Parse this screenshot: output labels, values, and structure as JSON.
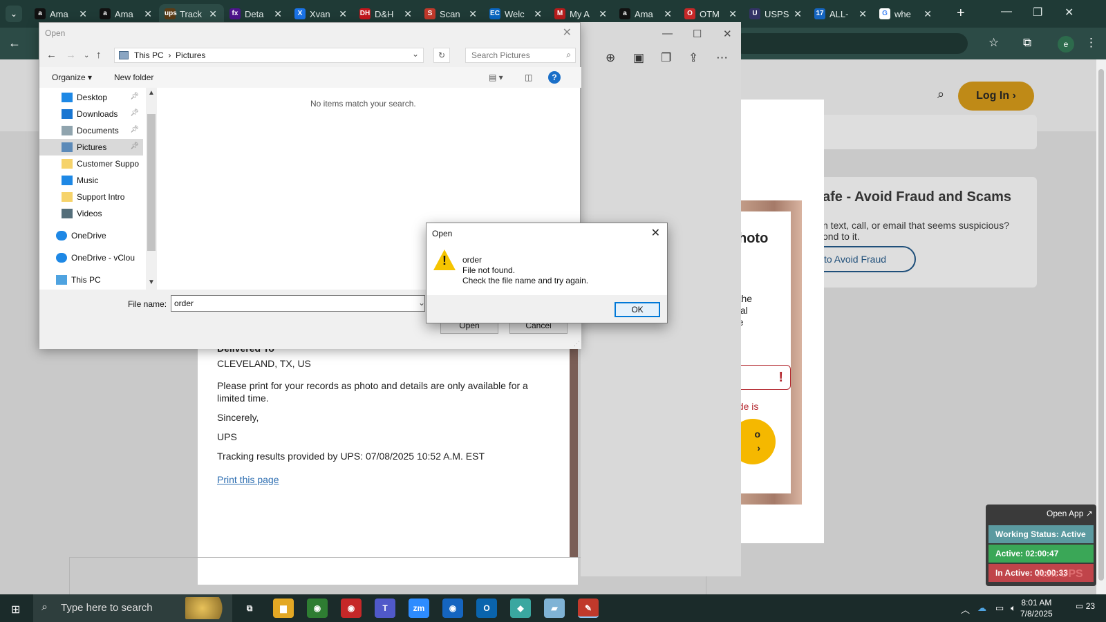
{
  "browser": {
    "tabs": [
      {
        "label": "Ama",
        "favicon": "amazon-icon",
        "color": "#111111",
        "glyph": "a"
      },
      {
        "label": "Ama",
        "favicon": "amazon-icon",
        "color": "#111111",
        "glyph": "a"
      },
      {
        "label": "Track",
        "favicon": "ups-icon",
        "color": "#5a3b15",
        "glyph": "ups",
        "active": true
      },
      {
        "label": "Deta",
        "favicon": "fedex-icon",
        "color": "#4d148c",
        "glyph": "fx"
      },
      {
        "label": "Xvan",
        "favicon": "xvantage-icon",
        "color": "#1a73e8",
        "glyph": "X"
      },
      {
        "label": "D&H",
        "favicon": "dh-icon",
        "color": "#c4161c",
        "glyph": "DH"
      },
      {
        "label": "Scan",
        "favicon": "scan-icon",
        "color": "#c0392b",
        "glyph": "S"
      },
      {
        "label": "Welc",
        "favicon": "ec-icon",
        "color": "#0a66c2",
        "glyph": "EC"
      },
      {
        "label": "My A",
        "favicon": "account-icon",
        "color": "#b71c1c",
        "glyph": "M"
      },
      {
        "label": "Ama",
        "favicon": "amazon-icon",
        "color": "#111111",
        "glyph": "a"
      },
      {
        "label": "OTM",
        "favicon": "otm-icon",
        "color": "#c62828",
        "glyph": "O"
      },
      {
        "label": "USPS",
        "favicon": "usps-icon",
        "color": "#333366",
        "glyph": "U"
      },
      {
        "label": "ALL-",
        "favicon": "17track-icon",
        "color": "#1565c0",
        "glyph": "17"
      },
      {
        "label": "whe",
        "favicon": "google-icon",
        "color": "#ffffff",
        "glyph": "G"
      }
    ],
    "profile_initial": "e"
  },
  "page": {
    "login_label": "Log In ›",
    "fraud_title": "afe - Avoid Fraud and Scams",
    "fraud_text": "n text, call, or email that seems suspicious?\nond to it.",
    "fraud_button": "to Avoid Fraud",
    "photo_modal": {
      "title": "hoto",
      "text_lines": [
        "r the",
        "stal",
        "he"
      ],
      "error_mark": "!",
      "error_text": "ode is",
      "yellow_button_line1": "o",
      "yellow_button_line2": "›"
    },
    "ups_card": {
      "delivered_to_label": "Delivered To",
      "address": "CLEVELAND, TX, US",
      "print_note_line1": "Please print for your records as photo and details are only available for a",
      "print_note_line2": "limited time.",
      "sincerely": "Sincerely,",
      "signature": "UPS",
      "tracking_results": "Tracking results provided by UPS: 07/08/2025 10:52 A.M. EST",
      "print_link": "Print this page"
    }
  },
  "open_dialog": {
    "title": "Open",
    "breadcrumb": [
      "This PC",
      "Pictures"
    ],
    "search_placeholder": "Search Pictures",
    "organize_label": "Organize ▾",
    "new_folder_label": "New folder",
    "nav_items": [
      {
        "label": "Desktop",
        "icon": "desktop-icon",
        "pinned": true,
        "color": "#1e88e5"
      },
      {
        "label": "Downloads",
        "icon": "downloads-icon",
        "pinned": true,
        "color": "#1976d2"
      },
      {
        "label": "Documents",
        "icon": "documents-icon",
        "pinned": true,
        "color": "#90a4ae"
      },
      {
        "label": "Pictures",
        "icon": "pictures-icon",
        "pinned": true,
        "color": "#5c8ab8",
        "selected": true
      },
      {
        "label": "Customer Suppo",
        "icon": "folder-icon",
        "pinned": false,
        "color": "#f6d36b"
      },
      {
        "label": "Music",
        "icon": "music-icon",
        "pinned": false,
        "color": "#1e88e5"
      },
      {
        "label": "Support Intro",
        "icon": "folder-icon",
        "pinned": false,
        "color": "#f6d36b"
      },
      {
        "label": "Videos",
        "icon": "videos-icon",
        "pinned": false,
        "color": "#546e7a"
      },
      {
        "label": "OneDrive",
        "icon": "onedrive-icon",
        "pinned": false,
        "color": "#1e88e5",
        "top_level": true
      },
      {
        "label": "OneDrive - vClou",
        "icon": "onedrive-icon",
        "pinned": false,
        "color": "#1e88e5",
        "top_level": true
      },
      {
        "label": "This PC",
        "icon": "thispc-icon",
        "pinned": false,
        "color": "#4fa3e0",
        "top_level": true
      }
    ],
    "empty_message": "No items match your search.",
    "filename_label": "File name:",
    "filename_value": "order",
    "open_button": "Open",
    "cancel_button": "Cancel"
  },
  "error_box": {
    "title": "Open",
    "filename": "order",
    "line2": "File not found.",
    "line3": "Check the file name and try again.",
    "ok_label": "OK"
  },
  "widget": {
    "open_app": "Open App ↗",
    "working_status": "Working Status: Active",
    "active_time": "Active: 02:00:47",
    "inactive_time": "In Active: 00:00:33",
    "ask_ups": "Ask UPS",
    "colors": {
      "status": "#5b9aa0",
      "active": "#3aa757",
      "inactive": "#c0444a"
    }
  },
  "taskbar": {
    "search_placeholder": "Type here to search",
    "time": "8:01 AM",
    "date": "7/8/2025",
    "notification_count": "23",
    "apps": [
      {
        "name": "task-view-icon",
        "glyph": "⧉",
        "color": "transparent"
      },
      {
        "name": "file-explorer-icon",
        "glyph": "▆",
        "color": "#e3a824"
      },
      {
        "name": "chrome-icon",
        "glyph": "◉",
        "color": "#2e7d32"
      },
      {
        "name": "chrome-profile-icon",
        "glyph": "◉",
        "color": "#c62828"
      },
      {
        "name": "teams-icon",
        "glyph": "T",
        "color": "#5059c9"
      },
      {
        "name": "zoom-icon",
        "glyph": "zm",
        "color": "#2d8cff"
      },
      {
        "name": "chrome-work-icon",
        "glyph": "◉",
        "color": "#1565c0"
      },
      {
        "name": "outlook-icon",
        "glyph": "O",
        "color": "#0a64ad"
      },
      {
        "name": "app-diamond-icon",
        "glyph": "◆",
        "color": "#3aa7a0"
      },
      {
        "name": "notes-app-icon",
        "glyph": "▰",
        "color": "#7fb3d5"
      },
      {
        "name": "ups-tool-icon",
        "glyph": "✎",
        "color": "#c0392b",
        "active": true
      }
    ]
  }
}
